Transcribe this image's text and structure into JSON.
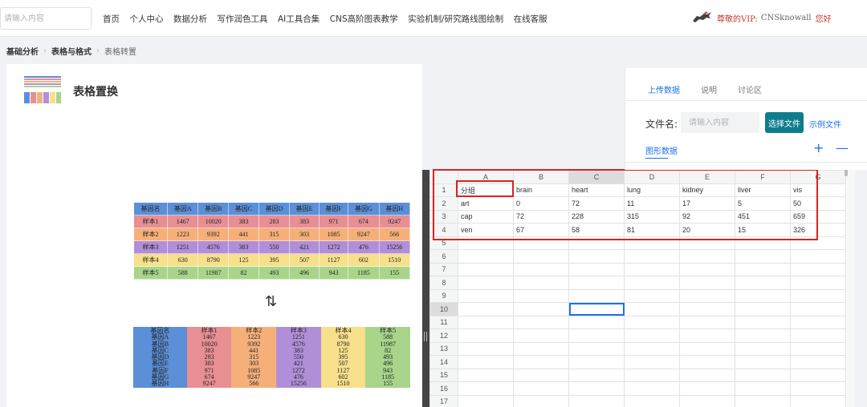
{
  "search": {
    "placeholder": "请输入内容"
  },
  "nav": {
    "items": [
      "首页",
      "个人中心",
      "数据分析",
      "写作润色工具",
      "AI工具合集",
      "CNS高阶图表教学",
      "实验机制/研究路线图绘制",
      "在线客服"
    ]
  },
  "user": {
    "prefix": "尊敬的VIP:",
    "name": "CNSknowall",
    "suffix": "您好"
  },
  "breadcrumb": {
    "level1": "基础分析",
    "level2": "表格与格式",
    "level3": "表格转置"
  },
  "page": {
    "title": "表格置换"
  },
  "swap_symbol": "⇅",
  "demo_table": {
    "headers": [
      "基因名",
      "基因A",
      "基因B",
      "基因C",
      "基因D",
      "基因E",
      "基因F",
      "基因G",
      "基因H"
    ],
    "rows": [
      [
        "样本1",
        "1467",
        "10020",
        "383",
        "283",
        "383",
        "971",
        "674",
        "9247"
      ],
      [
        "样本2",
        "1223",
        "9392",
        "441",
        "315",
        "303",
        "1085",
        "9247",
        "566"
      ],
      [
        "样本3",
        "1251",
        "4576",
        "383",
        "550",
        "421",
        "1272",
        "476",
        "15256"
      ],
      [
        "样本4",
        "630",
        "8790",
        "125",
        "395",
        "507",
        "1127",
        "602",
        "1510"
      ],
      [
        "样本5",
        "588",
        "11987",
        "82",
        "493",
        "496",
        "943",
        "1185",
        "155"
      ]
    ],
    "row_colors": [
      "#e88f94",
      "#f5b07a",
      "#b08fd8",
      "#f7e08c",
      "#a8d58a"
    ],
    "header_color": "#5b8fd8"
  },
  "transposed_table": {
    "headers": [
      "基因名",
      "样本1",
      "样本2",
      "样本3",
      "样本4",
      "样本5"
    ],
    "row_labels": [
      "基因A",
      "基因B",
      "基因C",
      "基因D",
      "基因E",
      "基因F",
      "基因G",
      "基因H"
    ],
    "columns": [
      [
        "1467",
        "10020",
        "383",
        "283",
        "383",
        "971",
        "674",
        "9247"
      ],
      [
        "1223",
        "9392",
        "441",
        "315",
        "303",
        "1085",
        "9247",
        "566"
      ],
      [
        "1251",
        "4576",
        "383",
        "550",
        "421",
        "1272",
        "476",
        "15256"
      ],
      [
        "630",
        "8790",
        "125",
        "395",
        "507",
        "1127",
        "602",
        "1510"
      ],
      [
        "588",
        "11987",
        "82",
        "493",
        "496",
        "943",
        "1185",
        "155"
      ]
    ],
    "col_colors": [
      "#5b8fd8",
      "#e88f94",
      "#f5b07a",
      "#b08fd8",
      "#f7e08c",
      "#a8d58a"
    ]
  },
  "sheet": {
    "col_headers": [
      "A",
      "B",
      "C",
      "D",
      "E",
      "F",
      "G"
    ],
    "selected_col": "C",
    "selected_row": 10,
    "total_rows": 17,
    "data": [
      [
        "分组",
        "brain",
        "heart",
        "lung",
        "kidney",
        "liver",
        "vis"
      ],
      [
        "art",
        "0",
        "72",
        "11",
        "17",
        "5",
        "50"
      ],
      [
        "cap",
        "72",
        "228",
        "315",
        "92",
        "451",
        "659"
      ],
      [
        "ven",
        "67",
        "58",
        "81",
        "20",
        "15",
        "326"
      ]
    ]
  },
  "panel": {
    "tabs": [
      "上传数据",
      "说明",
      "讨论区"
    ],
    "active_tab": "上传数据",
    "filename_label": "文件名:",
    "filename_placeholder": "请输入内容",
    "choose_button": "选择文件",
    "example_link": "示例文件",
    "figure_label": "图形数据",
    "plus": "+",
    "minus": "—"
  },
  "colors": {
    "accent": "#1a73e8",
    "button": "#0f7c8c",
    "highlight": "#e02020"
  },
  "icons": {
    "logo": "horse-logo-icon",
    "app": "table-grid-icon"
  }
}
